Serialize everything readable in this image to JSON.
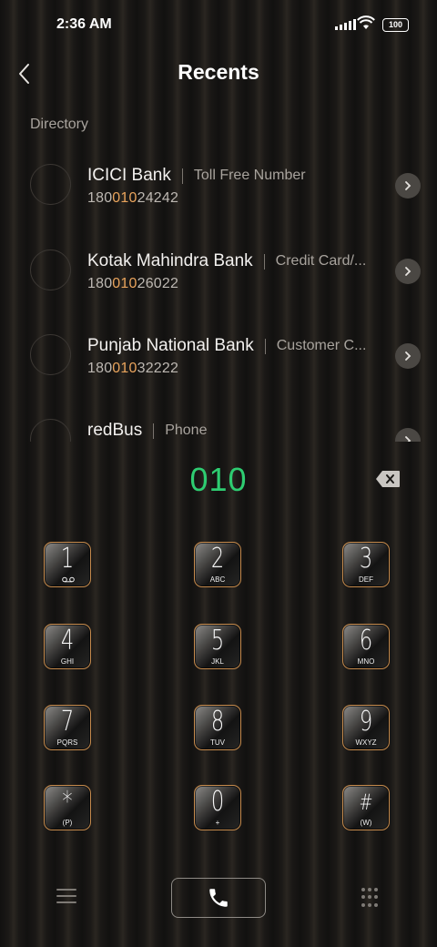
{
  "status_bar": {
    "time": "2:36 AM",
    "battery": "100"
  },
  "header": {
    "title": "Recents"
  },
  "section_label": "Directory",
  "contacts": [
    {
      "name": "ICICI Bank",
      "tag": "Toll Free Number",
      "number_pre": "180",
      "number_match": "010",
      "number_post": "24242"
    },
    {
      "name": "Kotak Mahindra Bank",
      "tag": "Credit Card/...",
      "number_pre": "180",
      "number_match": "010",
      "number_post": "26022"
    },
    {
      "name": "Punjab National Bank",
      "tag": "Customer C...",
      "number_pre": "180",
      "number_match": "010",
      "number_post": "32222"
    },
    {
      "name": "redBus",
      "tag": "Phone",
      "number_pre": "",
      "number_match": "",
      "number_post": ""
    }
  ],
  "dialed_number": "010",
  "keypad": [
    {
      "digit": "1",
      "letters": ""
    },
    {
      "digit": "2",
      "letters": "ABC"
    },
    {
      "digit": "3",
      "letters": "DEF"
    },
    {
      "digit": "4",
      "letters": "GHI"
    },
    {
      "digit": "5",
      "letters": "JKL"
    },
    {
      "digit": "6",
      "letters": "MNO"
    },
    {
      "digit": "7",
      "letters": "PQRS"
    },
    {
      "digit": "8",
      "letters": "TUV"
    },
    {
      "digit": "9",
      "letters": "WXYZ"
    },
    {
      "digit": "*",
      "letters": "(P)"
    },
    {
      "digit": "0",
      "letters": "+"
    },
    {
      "digit": "#",
      "letters": "(W)"
    }
  ],
  "colors": {
    "dialed": "#2ecc71",
    "match_highlight": "#e8a35c",
    "key_border": "#c58a4c"
  },
  "icons": [
    "back-icon",
    "chevron-right-icon",
    "backspace-icon",
    "voicemail-icon",
    "menu-icon",
    "phone-icon",
    "dialpad-icon"
  ]
}
